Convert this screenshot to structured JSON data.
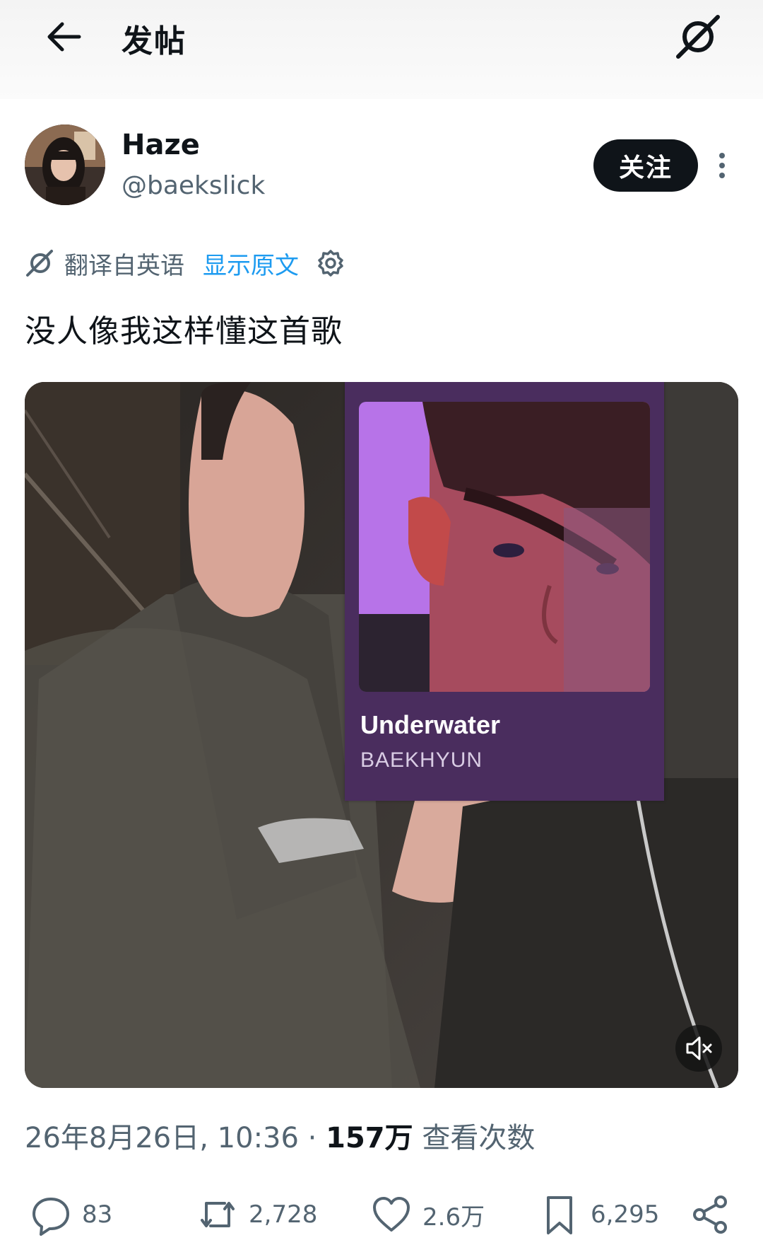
{
  "header": {
    "title": "发帖",
    "back_icon": "arrow-left-icon",
    "logo_icon": "app-logo-icon"
  },
  "author": {
    "display_name": "Haze",
    "handle": "@baekslick",
    "follow_label": "关注"
  },
  "translation": {
    "label": "翻译自英语",
    "show_original": "显示原文"
  },
  "post": {
    "text": "没人像我这样懂这首歌"
  },
  "media": {
    "song_title": "Underwater",
    "song_artist": "BAEKHYUN",
    "mute_icon": "volume-muted-icon"
  },
  "meta": {
    "timestamp": "26年8月26日, 10:36",
    "separator": "·",
    "views_count": "157万",
    "views_label": "查看次数"
  },
  "actions": {
    "replies": "83",
    "reposts": "2,728",
    "likes": "2.6万",
    "bookmarks": "6,295"
  },
  "colors": {
    "accent": "#1d9bf0",
    "text_primary": "#0f1419",
    "text_secondary": "#536471",
    "music_card": "#4a2d5e"
  }
}
